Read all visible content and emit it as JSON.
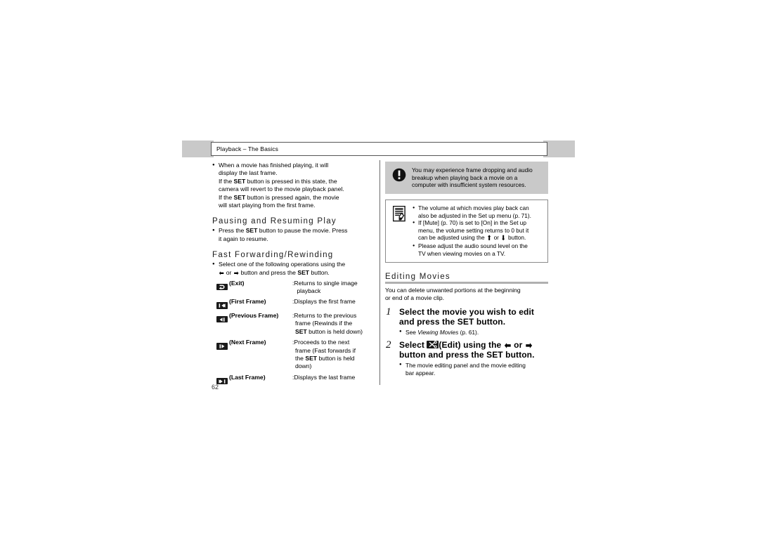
{
  "header": {
    "running_head": "Playback – The Basics",
    "block_left_name": "gray-block-left",
    "block_right_name": "gray-block-right"
  },
  "page_number": "62",
  "left_column": {
    "intro_bullet": {
      "lines": [
        "When a movie has finished playing, it will",
        "display the last frame.",
        "If the SET button is pressed in this state, the",
        "camera will revert to the movie playback panel.",
        "If the SET button is pressed again, the movie",
        "will start playing from the first frame."
      ]
    },
    "section_pausing": {
      "heading": "Pausing and Resuming Play",
      "bullet_lines": [
        "Press the SET button to pause the movie. Press",
        "it again to resume."
      ]
    },
    "section_fastforward": {
      "heading": "Fast Forwarding/Rewinding",
      "bullet_lines": [
        "Select one of the following operations using the",
        "← or → button and press the SET button."
      ],
      "operations": [
        {
          "icon": "exit-icon",
          "name": "(Exit)",
          "desc_lines": [
            ":Returns to single image",
            "playback"
          ]
        },
        {
          "icon": "first-frame-icon",
          "name": "(First Frame)",
          "desc_lines": [
            ":Displays the first frame"
          ]
        },
        {
          "icon": "previous-frame-icon",
          "name": "(Previous Frame)",
          "desc_lines": [
            ":Returns to the previous",
            "frame (Rewinds if the",
            "SET button is held down)"
          ]
        },
        {
          "icon": "next-frame-icon",
          "name": "(Next Frame)",
          "desc_lines": [
            ":Proceeds to the next",
            "frame (Fast forwards if",
            "the SET button is held",
            "down)"
          ]
        },
        {
          "icon": "last-frame-icon",
          "name": "(Last Frame)",
          "desc_lines": [
            ":Displays the last frame"
          ]
        }
      ]
    }
  },
  "right_column": {
    "caution_note": {
      "icon": "exclamation-icon",
      "lines": [
        "You may experience frame dropping and audio",
        "breakup when playing back a movie on a",
        "computer with insufficient system resources."
      ]
    },
    "info_note": {
      "icon": "note-document-icon",
      "bullets": [
        [
          "The volume at which movies play back can",
          "also be adjusted in the Set up menu (p. 71)."
        ],
        [
          "If [Mute] (p. 70) is set to [On] in the Set up",
          "menu, the volume setting returns to 0 but it",
          "can be adjusted using the ↑ or ↓ button."
        ],
        [
          "Please adjust the audio sound level on the",
          "TV when viewing movies on a TV."
        ]
      ]
    },
    "section_editing": {
      "heading": "Editing Movies",
      "intro_lines": [
        "You can delete unwanted portions at the beginning",
        "or end of a movie clip."
      ],
      "steps": [
        {
          "number": "1",
          "title_lines": [
            "Select the movie you wish to edit",
            "and press the SET button."
          ],
          "sub_prefix": "See ",
          "sub_italic": "Viewing Movies",
          "sub_suffix": " (p. 61).",
          "icon": null
        },
        {
          "number": "2",
          "title_part1": "Select ",
          "icon": "scissors-edit-icon",
          "title_part2": "(Edit) using the ",
          "title_arrow1": "←",
          "title_mid": " or ",
          "title_arrow2": "→",
          "title_line2": "button and press the SET button.",
          "sub_lines": [
            "The movie editing panel and the movie editing",
            "bar appear."
          ]
        }
      ]
    }
  },
  "colors": {
    "gray_block": "#c9c9c9",
    "note_gray": "#c9c9c9",
    "rule_gray": "#b0b0b0",
    "border_gray": "#8a8a8a",
    "text": "#000000"
  }
}
